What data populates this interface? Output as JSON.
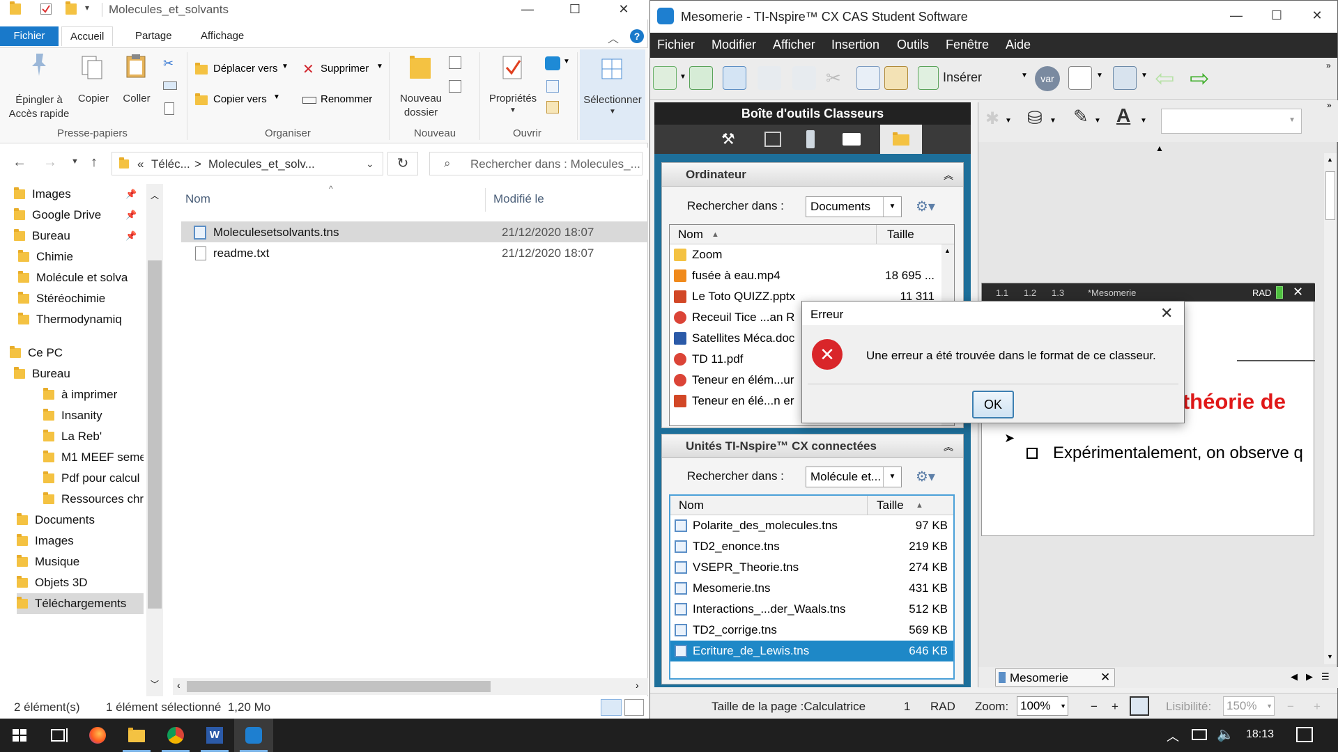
{
  "explorer": {
    "title": "Molecules_et_solvants",
    "ribbon_tabs": [
      "Fichier",
      "Accueil",
      "Partage",
      "Affichage"
    ],
    "ribbon": {
      "pin_label_1": "Épingler à",
      "pin_label_2": "Accès rapide",
      "copy": "Copier",
      "paste": "Coller",
      "group_clipboard": "Presse-papiers",
      "move_to": "Déplacer vers",
      "copy_to": "Copier vers",
      "delete": "Supprimer",
      "rename": "Renommer",
      "group_organize": "Organiser",
      "new_folder_1": "Nouveau",
      "new_folder_2": "dossier",
      "group_new": "Nouveau",
      "properties": "Propriétés",
      "group_open": "Ouvrir",
      "select": "Sélectionner"
    },
    "address": {
      "prefix": "«",
      "segment_1": "Téléc...",
      "separator": ">",
      "segment_2": "Molecules_et_solv...",
      "search_placeholder": "Rechercher dans : Molecules_..."
    },
    "nav": [
      {
        "label": "Images",
        "pinned": true
      },
      {
        "label": "Google Drive",
        "pinned": true
      },
      {
        "label": "Bureau",
        "pinned": true
      },
      {
        "label": "Chimie"
      },
      {
        "label": "Molécule et solva"
      },
      {
        "label": "Stéréochimie"
      },
      {
        "label": "Thermodynamiq"
      },
      {
        "label": "Ce PC"
      },
      {
        "label": "Bureau"
      },
      {
        "label": "à imprimer"
      },
      {
        "label": "Insanity"
      },
      {
        "label": "La Reb'"
      },
      {
        "label": "M1 MEEF seme"
      },
      {
        "label": "Pdf pour calcul"
      },
      {
        "label": "Ressources chre"
      },
      {
        "label": "Documents"
      },
      {
        "label": "Images"
      },
      {
        "label": "Musique"
      },
      {
        "label": "Objets 3D"
      },
      {
        "label": "Téléchargements"
      }
    ],
    "columns": {
      "name": "Nom",
      "modified": "Modifié le"
    },
    "files": [
      {
        "name": "Moleculesetsolvants.tns",
        "modified": "21/12/2020 18:07",
        "selected": true
      },
      {
        "name": "readme.txt",
        "modified": "21/12/2020 18:07",
        "selected": false
      }
    ],
    "status": {
      "count": "2 élément(s)",
      "selection": "1 élément sélectionné  1,20 Mo"
    }
  },
  "nspire": {
    "title": "Mesomerie - TI-Nspire™ CX CAS Student Software",
    "menus": [
      "Fichier",
      "Modifier",
      "Afficher",
      "Insertion",
      "Outils",
      "Fenêtre",
      "Aide"
    ],
    "insert_label": "Insérer",
    "var_label": "var",
    "toolbox_title": "Boîte d'outils Classeurs",
    "computer_panel": {
      "title": "Ordinateur",
      "lookin_label": "Rechercher dans :",
      "lookin_value": "Documents",
      "col_name": "Nom",
      "col_size": "Taille",
      "rows": [
        {
          "name": "Zoom",
          "size": "",
          "type": "folder"
        },
        {
          "name": "fusée à eau.mp4",
          "size": "18 695 ...",
          "type": "vlc"
        },
        {
          "name": "Le Toto QUIZZ.pptx",
          "size": "11 311",
          "type": "ppt"
        },
        {
          "name": "Receuil Tice ...an R",
          "size": "",
          "type": "chrome"
        },
        {
          "name": "Satellites Méca.doc",
          "size": "",
          "type": "word"
        },
        {
          "name": "TD 11.pdf",
          "size": "",
          "type": "chrome"
        },
        {
          "name": "Teneur en élém...ur",
          "size": "",
          "type": "chrome"
        },
        {
          "name": "Teneur en élé...n er",
          "size": "",
          "type": "ppt"
        }
      ]
    },
    "units_panel": {
      "title": "Unités TI-Nspire™ CX connectées",
      "lookin_label": "Rechercher dans :",
      "lookin_value": "Molécule et...",
      "col_name": "Nom",
      "col_size": "Taille",
      "rows": [
        {
          "name": "Polarite_des_molecules.tns",
          "size": "97 KB"
        },
        {
          "name": "TD2_enonce.tns",
          "size": "219 KB"
        },
        {
          "name": "VSEPR_Theorie.tns",
          "size": "274 KB"
        },
        {
          "name": "Mesomerie.tns",
          "size": "431 KB"
        },
        {
          "name": "Interactions_...der_Waals.tns",
          "size": "512 KB"
        },
        {
          "name": "TD2_corrige.tns",
          "size": "569 KB"
        },
        {
          "name": "Ecriture_de_Lewis.tns",
          "size": "646 KB",
          "selected": true
        }
      ]
    },
    "doc": {
      "tabs": [
        "1.1",
        "1.2",
        "1.3"
      ],
      "doc_name": "*Mesomerie",
      "mode": "RAD",
      "heading": "Retour sur la théorie de",
      "bullet": "Expérimentalement, on observe q",
      "tab_label": "Mesomerie"
    },
    "status": {
      "page_size": "Taille de la page :Calculatrice",
      "page_num": "1",
      "angle": "RAD",
      "zoom_label": "Zoom:",
      "zoom_value": "100%",
      "legibility_label": "Lisibilité:",
      "legibility_value": "150%"
    }
  },
  "dialog": {
    "title": "Erreur",
    "message": "Une erreur a été trouvée dans le format de ce classeur.",
    "ok": "OK"
  },
  "taskbar": {
    "time": "18:13"
  },
  "colors": {
    "explorer_accent": "#1979ca",
    "nspire_menubar": "#2b2b2b",
    "toolbox_blue": "#1d6f9a",
    "selection_blue": "#1e88c7",
    "error_red": "#d9262a",
    "heading_red": "#e01818"
  }
}
